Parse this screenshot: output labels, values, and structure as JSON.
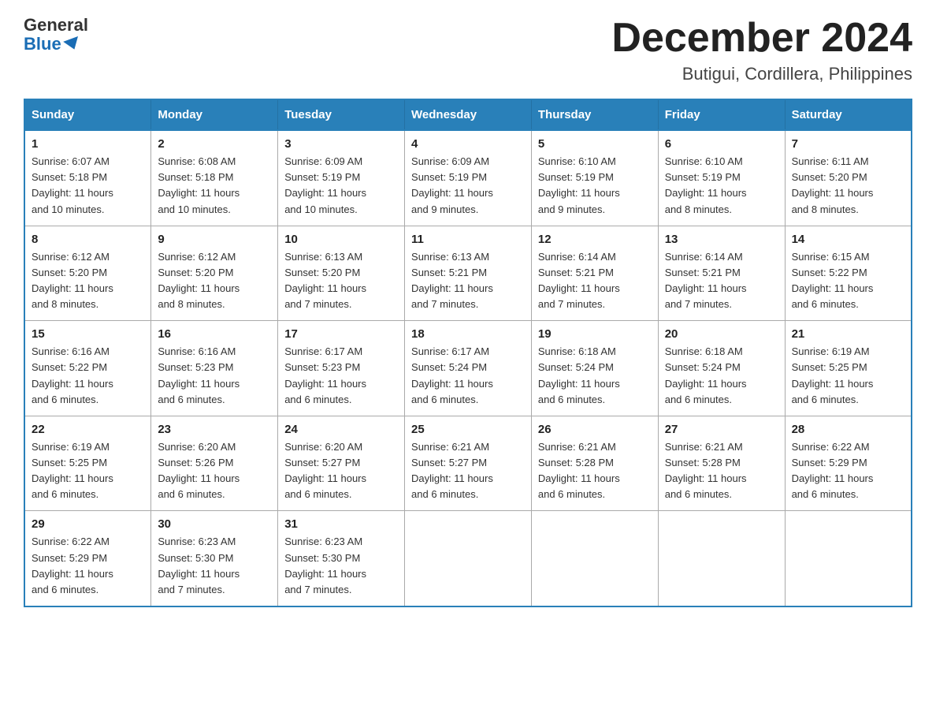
{
  "header": {
    "logo_general": "General",
    "logo_blue": "Blue",
    "month_title": "December 2024",
    "subtitle": "Butigui, Cordillera, Philippines"
  },
  "days_of_week": [
    "Sunday",
    "Monday",
    "Tuesday",
    "Wednesday",
    "Thursday",
    "Friday",
    "Saturday"
  ],
  "weeks": [
    [
      {
        "day": "1",
        "sunrise": "6:07 AM",
        "sunset": "5:18 PM",
        "daylight": "11 hours and 10 minutes."
      },
      {
        "day": "2",
        "sunrise": "6:08 AM",
        "sunset": "5:18 PM",
        "daylight": "11 hours and 10 minutes."
      },
      {
        "day": "3",
        "sunrise": "6:09 AM",
        "sunset": "5:19 PM",
        "daylight": "11 hours and 10 minutes."
      },
      {
        "day": "4",
        "sunrise": "6:09 AM",
        "sunset": "5:19 PM",
        "daylight": "11 hours and 9 minutes."
      },
      {
        "day": "5",
        "sunrise": "6:10 AM",
        "sunset": "5:19 PM",
        "daylight": "11 hours and 9 minutes."
      },
      {
        "day": "6",
        "sunrise": "6:10 AM",
        "sunset": "5:19 PM",
        "daylight": "11 hours and 8 minutes."
      },
      {
        "day": "7",
        "sunrise": "6:11 AM",
        "sunset": "5:20 PM",
        "daylight": "11 hours and 8 minutes."
      }
    ],
    [
      {
        "day": "8",
        "sunrise": "6:12 AM",
        "sunset": "5:20 PM",
        "daylight": "11 hours and 8 minutes."
      },
      {
        "day": "9",
        "sunrise": "6:12 AM",
        "sunset": "5:20 PM",
        "daylight": "11 hours and 8 minutes."
      },
      {
        "day": "10",
        "sunrise": "6:13 AM",
        "sunset": "5:20 PM",
        "daylight": "11 hours and 7 minutes."
      },
      {
        "day": "11",
        "sunrise": "6:13 AM",
        "sunset": "5:21 PM",
        "daylight": "11 hours and 7 minutes."
      },
      {
        "day": "12",
        "sunrise": "6:14 AM",
        "sunset": "5:21 PM",
        "daylight": "11 hours and 7 minutes."
      },
      {
        "day": "13",
        "sunrise": "6:14 AM",
        "sunset": "5:21 PM",
        "daylight": "11 hours and 7 minutes."
      },
      {
        "day": "14",
        "sunrise": "6:15 AM",
        "sunset": "5:22 PM",
        "daylight": "11 hours and 6 minutes."
      }
    ],
    [
      {
        "day": "15",
        "sunrise": "6:16 AM",
        "sunset": "5:22 PM",
        "daylight": "11 hours and 6 minutes."
      },
      {
        "day": "16",
        "sunrise": "6:16 AM",
        "sunset": "5:23 PM",
        "daylight": "11 hours and 6 minutes."
      },
      {
        "day": "17",
        "sunrise": "6:17 AM",
        "sunset": "5:23 PM",
        "daylight": "11 hours and 6 minutes."
      },
      {
        "day": "18",
        "sunrise": "6:17 AM",
        "sunset": "5:24 PM",
        "daylight": "11 hours and 6 minutes."
      },
      {
        "day": "19",
        "sunrise": "6:18 AM",
        "sunset": "5:24 PM",
        "daylight": "11 hours and 6 minutes."
      },
      {
        "day": "20",
        "sunrise": "6:18 AM",
        "sunset": "5:24 PM",
        "daylight": "11 hours and 6 minutes."
      },
      {
        "day": "21",
        "sunrise": "6:19 AM",
        "sunset": "5:25 PM",
        "daylight": "11 hours and 6 minutes."
      }
    ],
    [
      {
        "day": "22",
        "sunrise": "6:19 AM",
        "sunset": "5:25 PM",
        "daylight": "11 hours and 6 minutes."
      },
      {
        "day": "23",
        "sunrise": "6:20 AM",
        "sunset": "5:26 PM",
        "daylight": "11 hours and 6 minutes."
      },
      {
        "day": "24",
        "sunrise": "6:20 AM",
        "sunset": "5:27 PM",
        "daylight": "11 hours and 6 minutes."
      },
      {
        "day": "25",
        "sunrise": "6:21 AM",
        "sunset": "5:27 PM",
        "daylight": "11 hours and 6 minutes."
      },
      {
        "day": "26",
        "sunrise": "6:21 AM",
        "sunset": "5:28 PM",
        "daylight": "11 hours and 6 minutes."
      },
      {
        "day": "27",
        "sunrise": "6:21 AM",
        "sunset": "5:28 PM",
        "daylight": "11 hours and 6 minutes."
      },
      {
        "day": "28",
        "sunrise": "6:22 AM",
        "sunset": "5:29 PM",
        "daylight": "11 hours and 6 minutes."
      }
    ],
    [
      {
        "day": "29",
        "sunrise": "6:22 AM",
        "sunset": "5:29 PM",
        "daylight": "11 hours and 6 minutes."
      },
      {
        "day": "30",
        "sunrise": "6:23 AM",
        "sunset": "5:30 PM",
        "daylight": "11 hours and 7 minutes."
      },
      {
        "day": "31",
        "sunrise": "6:23 AM",
        "sunset": "5:30 PM",
        "daylight": "11 hours and 7 minutes."
      },
      null,
      null,
      null,
      null
    ]
  ],
  "labels": {
    "sunrise": "Sunrise:",
    "sunset": "Sunset:",
    "daylight": "Daylight:"
  }
}
